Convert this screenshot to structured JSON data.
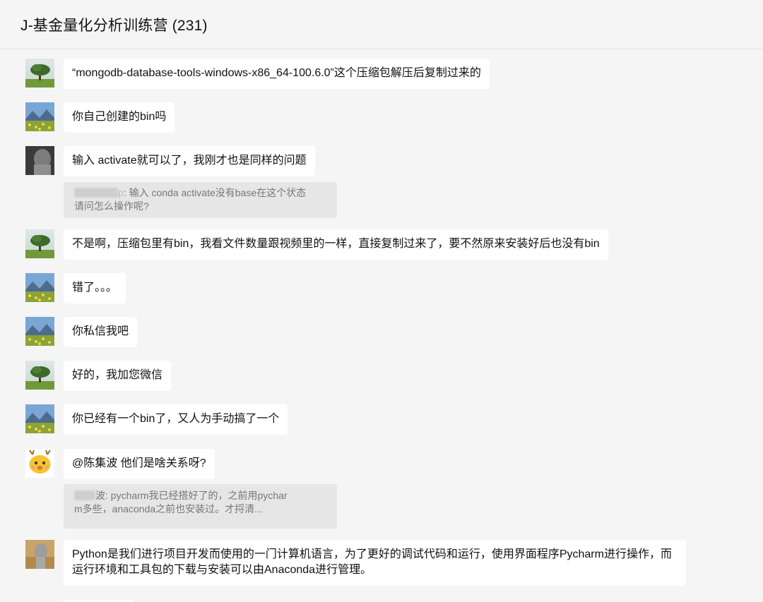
{
  "header": {
    "title": "J-基金量化分析训练营 (231)"
  },
  "messages": [
    {
      "avatar": "tree-avatar-icon",
      "text": "“mongodb-database-tools-windows-x86_64-100.6.0”这个压缩包解压后复制过来的"
    },
    {
      "avatar": "landscape-flowers-avatar-icon",
      "text": "你自己创建的bin吗"
    },
    {
      "avatar": "blurred-person-avatar-icon",
      "text": "输入 activate就可以了，我刚才也是同样的问题",
      "quote": {
        "prefix": "p",
        "line1": ": 输入 conda activate没有base在这个状态",
        "line2": "请问怎么操作呢?"
      }
    },
    {
      "avatar": "tree-avatar-icon",
      "text": "不是啊，压缩包里有bin，我看文件数量跟视频里的一样，直接复制过来了，要不然原来安装好后也没有bin"
    },
    {
      "avatar": "landscape-flowers-avatar-icon",
      "text": "错了。。。"
    },
    {
      "avatar": "landscape-flowers-avatar-icon",
      "text": "你私信我吧"
    },
    {
      "avatar": "tree-avatar-icon",
      "text": "好的，我加您微信"
    },
    {
      "avatar": "landscape-flowers-avatar-icon",
      "text": "你已经有一个bin了，又人为手动搞了一个"
    },
    {
      "avatar": "cartoon-deer-avatar-icon",
      "text": "@陈集波 他们是啥关系呀?",
      "quote": {
        "prefix": "波",
        "line1": ": pycharm我已经搭好了的，之前用pychar",
        "line2": "m多些，anaconda之前也安装过。才捋清..."
      }
    },
    {
      "avatar": "blurred-field-avatar-icon",
      "text": "Python是我们进行项目开发而使用的一门计算机语言，为了更好的调试代码和运行，使用界面程序Pycharm进行操作，而运行环境和工具包的下载与安装可以由Anaconda进行管理。"
    }
  ]
}
